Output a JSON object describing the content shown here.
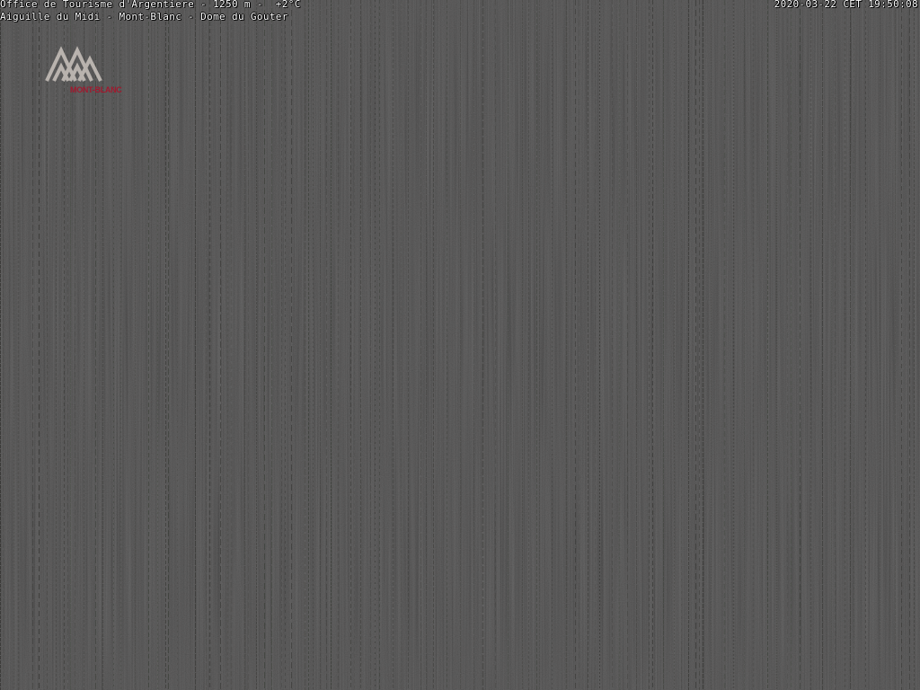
{
  "overlay": {
    "station_line": "Office de Tourisme d'Argentiere - 1250 m -  +2°C",
    "view_line": "Aiguille du Midi - Mont-Blanc - Dome du Gouter",
    "timestamp": "2020-03-22 CET 19:50:08"
  },
  "logo": {
    "text": "MONT-BLANC",
    "mark_color": "#b9b3ae",
    "text_color": "#a0192e"
  },
  "scene": {
    "description_color": "#1c1b1b"
  }
}
